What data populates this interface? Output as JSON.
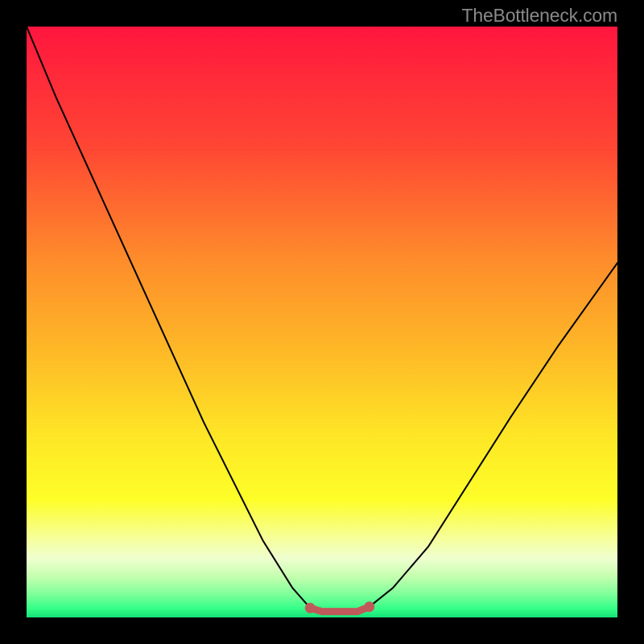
{
  "watermark": "TheBottleneck.com",
  "chart_data": {
    "type": "line",
    "title": "",
    "xlabel": "",
    "ylabel": "",
    "xlim": [
      0,
      100
    ],
    "ylim": [
      0,
      100
    ],
    "grid": false,
    "series": [
      {
        "name": "bottleneck-curve",
        "x": [
          0,
          5,
          10,
          15,
          20,
          25,
          30,
          35,
          40,
          45,
          48,
          50,
          52,
          54,
          56,
          58,
          62,
          68,
          75,
          82,
          90,
          100
        ],
        "y": [
          100,
          88,
          77,
          66,
          55,
          44,
          33,
          23,
          13,
          5,
          1.6,
          1.0,
          1.0,
          1.0,
          1.0,
          1.8,
          5,
          12,
          23,
          34,
          46,
          60
        ]
      }
    ],
    "min_band": {
      "x_range": [
        48,
        58
      ],
      "color": "#c05a5a"
    },
    "background_gradient": {
      "stops": [
        {
          "offset": 0.0,
          "color": "#ff163e"
        },
        {
          "offset": 0.2,
          "color": "#ff4534"
        },
        {
          "offset": 0.4,
          "color": "#fe8e2b"
        },
        {
          "offset": 0.55,
          "color": "#feb927"
        },
        {
          "offset": 0.7,
          "color": "#fee826"
        },
        {
          "offset": 0.8,
          "color": "#fefe28"
        },
        {
          "offset": 0.87,
          "color": "#f5ffa0"
        },
        {
          "offset": 0.9,
          "color": "#efffd0"
        },
        {
          "offset": 0.93,
          "color": "#c6ffb0"
        },
        {
          "offset": 0.96,
          "color": "#80ff9a"
        },
        {
          "offset": 0.985,
          "color": "#35ff88"
        },
        {
          "offset": 1.0,
          "color": "#14e077"
        }
      ]
    }
  }
}
